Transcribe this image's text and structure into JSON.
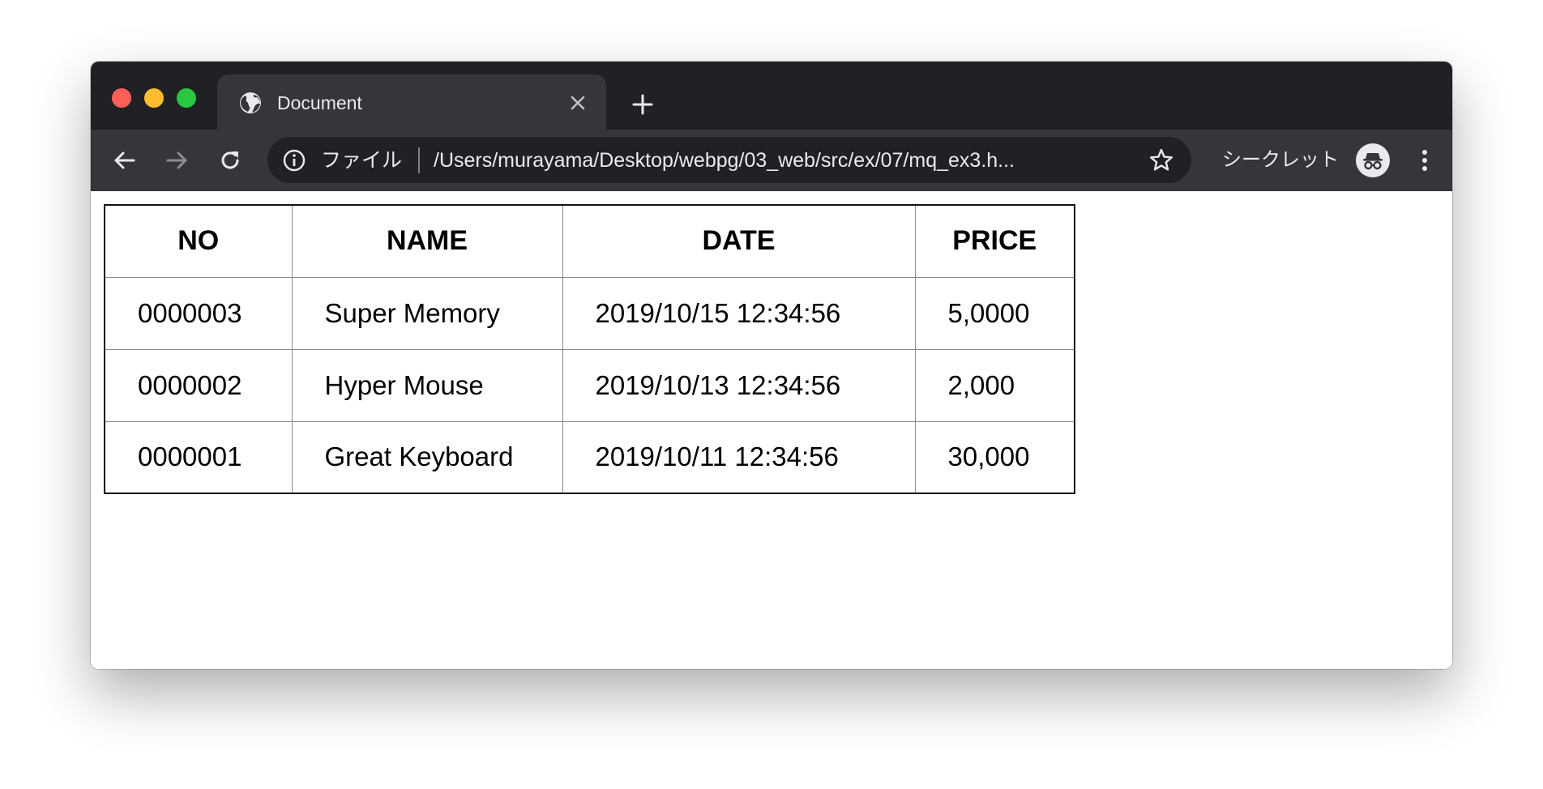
{
  "browser": {
    "tab": {
      "title": "Document"
    },
    "omnibox": {
      "scheme_label": "ファイル",
      "url": "/Users/murayama/Desktop/webpg/03_web/src/ex/07/mq_ex3.h..."
    },
    "incognito_label": "シークレット",
    "icons": {
      "favicon": "globe-icon",
      "tab_close": "close-icon",
      "new_tab": "plus-icon",
      "back": "arrow-left-icon",
      "forward": "arrow-right-icon",
      "reload": "reload-icon",
      "info": "info-icon",
      "bookmark": "star-icon",
      "incognito": "incognito-icon",
      "menu": "kebab-menu-icon"
    },
    "colors": {
      "tabstrip": "#202124",
      "toolbar": "#35363a",
      "omnibox": "#202124",
      "traffic_red": "#ff5f57",
      "traffic_yellow": "#febc2e",
      "traffic_green": "#28c840"
    }
  },
  "table": {
    "headers": {
      "no": "NO",
      "name": "NAME",
      "date": "DATE",
      "price": "PRICE"
    },
    "rows": [
      {
        "no": "0000003",
        "name": "Super Memory",
        "date": "2019/10/15 12:34:56",
        "price": "5,0000"
      },
      {
        "no": "0000002",
        "name": "Hyper Mouse",
        "date": "2019/10/13 12:34:56",
        "price": "2,000"
      },
      {
        "no": "0000001",
        "name": "Great Keyboard",
        "date": "2019/10/11 12:34:56",
        "price": "30,000"
      }
    ]
  }
}
